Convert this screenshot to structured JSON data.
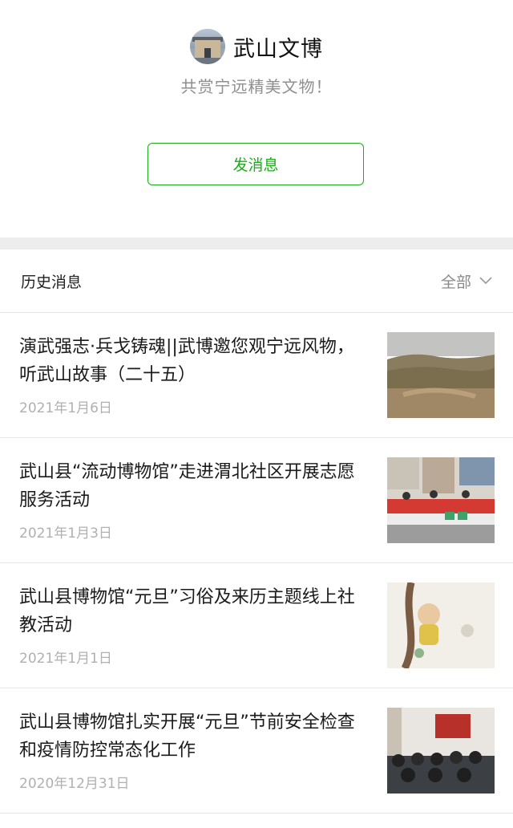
{
  "account": {
    "name": "武山文博",
    "slogan": "共赏宁远精美文物！",
    "send_button": "发消息"
  },
  "history": {
    "title": "历史消息",
    "filter_label": "全部"
  },
  "articles": [
    {
      "title": "演武强志·兵戈铸魂||武博邀您观宁远风物，听武山故事（二十五）",
      "date": "2021年1月6日"
    },
    {
      "title": "武山县“流动博物馆”走进渭北社区开展志愿服务活动",
      "date": "2021年1月3日"
    },
    {
      "title": "武山县博物馆“元旦”习俗及来历主题线上社教活动",
      "date": "2021年1月1日"
    },
    {
      "title": "武山县博物馆扎实开展“元旦”节前安全检查和疫情防控常态化工作",
      "date": "2020年12月31日"
    }
  ],
  "colors": {
    "accent": "#1aad19",
    "divider": "#ededed",
    "muted": "#b0b0b0"
  }
}
